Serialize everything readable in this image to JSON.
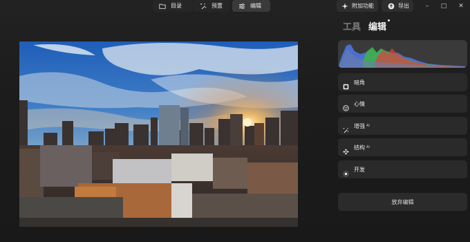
{
  "toolbar": {
    "catalog_label": "目录",
    "preview_label": "预置",
    "edit_label": "编辑",
    "addons_label": "附加功能",
    "export_label": "导出"
  },
  "window": {
    "minimize": "–",
    "maximize": "□",
    "close": "✕"
  },
  "panel": {
    "tab_tools": "工具",
    "tab_edit": "编辑",
    "tools": [
      {
        "label": "暗角",
        "badge": ""
      },
      {
        "label": "心情",
        "badge": ""
      },
      {
        "label": "增强",
        "badge": "AI"
      },
      {
        "label": "结构",
        "badge": "AI"
      },
      {
        "label": "开发",
        "badge": ""
      }
    ],
    "discard_label": "放弃编辑"
  },
  "histogram": {
    "colors": {
      "blue": "#4b6fd0",
      "green": "#3fb04a",
      "red": "#d44444",
      "bg": "#3a3a3a"
    }
  }
}
